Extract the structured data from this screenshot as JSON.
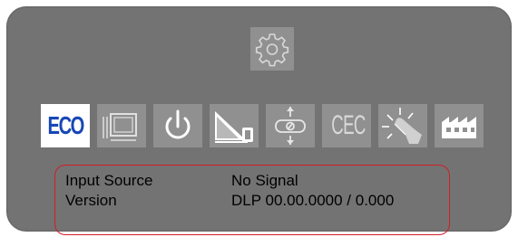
{
  "menu": {
    "header_icon": "gear-icon",
    "items": [
      {
        "icon": "eco-icon",
        "label": "ECO",
        "selected": true
      },
      {
        "icon": "screen-aspect-icon",
        "label": ""
      },
      {
        "icon": "power-icon",
        "label": ""
      },
      {
        "icon": "projection-angle-icon",
        "label": ""
      },
      {
        "icon": "lens-shift-icon",
        "label": ""
      },
      {
        "icon": "cec-icon",
        "label": "CEC"
      },
      {
        "icon": "touch-light-icon",
        "label": ""
      },
      {
        "icon": "factory-reset-icon",
        "label": ""
      }
    ]
  },
  "info": {
    "rows": [
      {
        "label": "Input Source",
        "value": "No Signal"
      },
      {
        "label": "Version",
        "value": "DLP 00.00.0000 / 0.000"
      }
    ]
  },
  "colors": {
    "panel_bg": "#737373",
    "tile_bg": "#909090",
    "selected_bg": "#ffffff",
    "eco_text": "#1747b6",
    "highlight_border": "#d31c24"
  }
}
